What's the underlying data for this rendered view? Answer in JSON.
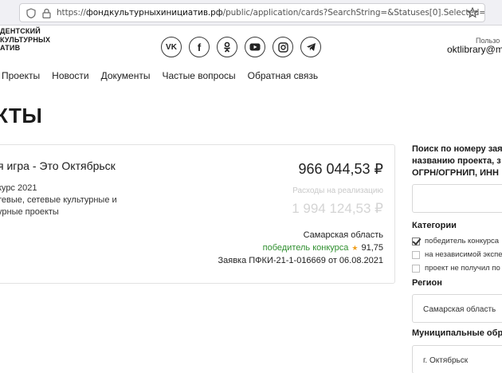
{
  "browser": {
    "url_prefix": "https://",
    "url_domain": "фондкультурныхинициатив.рф",
    "url_path": "/public/application/cards?SearchString=&Statuses[0].Selected=true&Statuses[0].Na"
  },
  "header": {
    "logo_lines": [
      "ДЕНТСКИЙ",
      "КУЛЬТУРНЫХ",
      "АТИВ"
    ],
    "socials": [
      {
        "name": "vk-icon",
        "label": "VK"
      },
      {
        "name": "facebook-icon",
        "label": "f"
      },
      {
        "name": "odnoklassniki-icon",
        "label": ""
      },
      {
        "name": "youtube-icon",
        "label": ""
      },
      {
        "name": "instagram-icon",
        "label": ""
      },
      {
        "name": "telegram-icon",
        "label": ""
      }
    ],
    "user_label": "Пользо",
    "user_email": "oktlibrary@m"
  },
  "nav": {
    "items": [
      "Проекты",
      "Новости",
      "Документы",
      "Частые вопросы",
      "Обратная связь"
    ]
  },
  "page": {
    "title": "КТЫ"
  },
  "card": {
    "title": "я игра - Это Октябрьск",
    "sub1": "курс 2021",
    "sub2": "тевые, сетевые культурные и",
    "sub3": "урные проекты",
    "amount": "966 044,53 ₽",
    "expense_label": "Расходы на реализацию",
    "expense_amount": "1 994 124,53 ₽",
    "region": "Самарская область",
    "status": "победитель конкурса",
    "score_icon": "★",
    "score": "91,75",
    "application": "Заявка ПФКИ-21-1-016669 от 06.08.2021"
  },
  "filters": {
    "search_label_lines": [
      "Поиск по номеру зая",
      "названию проекта, з",
      "ОГРН/ОГРНИП, ИНН"
    ],
    "categories_label": "Категории",
    "categories": [
      {
        "label": "победитель конкурса",
        "checked": true
      },
      {
        "label": "на независимой экспе",
        "checked": false
      },
      {
        "label": "проект не получил по",
        "checked": false
      }
    ],
    "region_label": "Регион",
    "region_value": "Самарская область",
    "muni_label": "Муниципальные обр",
    "muni_value": "г. Октябрьск"
  }
}
